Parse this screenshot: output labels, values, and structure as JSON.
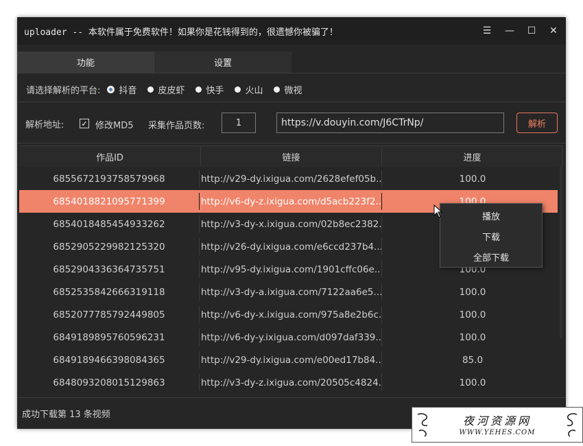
{
  "window": {
    "title": "uploader -- 本软件属于免费软件！如果你是花钱得到的，很遗憾你被骗了！",
    "controls": {
      "menu_glyph": "☰",
      "minimize_glyph": "—",
      "maximize_glyph": "☐",
      "close_glyph": "✕"
    }
  },
  "tabs": [
    {
      "label": "功能",
      "active": true
    },
    {
      "label": "设置",
      "active": false
    }
  ],
  "platform": {
    "label": "请选择解析的平台:",
    "options": [
      {
        "label": "抖音",
        "checked": true
      },
      {
        "label": "皮皮虾",
        "checked": false
      },
      {
        "label": "快手",
        "checked": false
      },
      {
        "label": "火山",
        "checked": false
      },
      {
        "label": "微视",
        "checked": false
      }
    ]
  },
  "form": {
    "address_label": "解析地址:",
    "md5_label": "修改MD5",
    "md5_checked": true,
    "pages_label": "采集作品页数:",
    "pages_value": "1",
    "url_value": "https://v.douyin.com/J6CTrNp/",
    "parse_label": "解析"
  },
  "table": {
    "columns": [
      "作品ID",
      "链接",
      "进度"
    ],
    "selected_index": 1,
    "rows": [
      {
        "id": "6855672193758579968",
        "link": "http://v29-dy.ixigua.com/2628efef05b...",
        "progress": "100.0"
      },
      {
        "id": "6854018821095771399",
        "link": "http://v6-dy-z.ixigua.com/d5acb223f2...",
        "progress": "100.0"
      },
      {
        "id": "6854018485454933262",
        "link": "http://v3-dy-x.ixigua.com/02b8ec2382...",
        "progress": "100.0"
      },
      {
        "id": "6852905229982125320",
        "link": "http://v26-dy.ixigua.com/e6ccd237b4...",
        "progress": "100.0"
      },
      {
        "id": "6852904336364735751",
        "link": "http://v95-dy.ixigua.com/1901cffc06e...",
        "progress": "100.0"
      },
      {
        "id": "6852535842666319118",
        "link": "http://v3-dy-a.ixigua.com/7122aa6e5...",
        "progress": "100.0"
      },
      {
        "id": "6852077785792449805",
        "link": "http://v6-dy-x.ixigua.com/975a8e2b6c...",
        "progress": "100.0"
      },
      {
        "id": "6849189895760596231",
        "link": "http://v6-dy-y.ixigua.com/d097daf339...",
        "progress": "100.0"
      },
      {
        "id": "6849189466398084365",
        "link": "http://v29-dy.ixigua.com/e00ed17b84...",
        "progress": "85.0"
      },
      {
        "id": "6848093208015129863",
        "link": "http://v3-dy-z.ixigua.com/20505c4824...",
        "progress": "100.0"
      }
    ]
  },
  "context_menu": {
    "items": [
      "播放",
      "下载",
      "全部下载"
    ]
  },
  "status": {
    "text": "成功下载第 13 条视频"
  },
  "watermark": {
    "title": "夜河资源网",
    "url": "WWW.YEHES.COM"
  },
  "colors": {
    "accent": "#f0846a",
    "window_bg": "#262626",
    "titlebar_bg": "#1f1f1f"
  }
}
